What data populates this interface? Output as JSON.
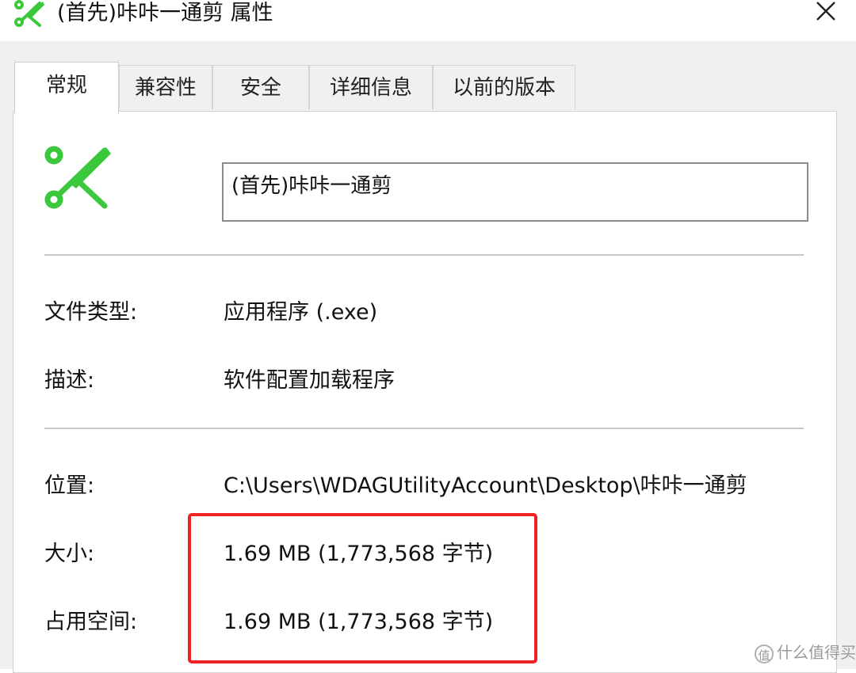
{
  "window": {
    "title": "(首先)咔咔一通剪 属性",
    "app_icon": "scissors-icon",
    "close_icon": "close-icon"
  },
  "tabs": [
    {
      "label": "常规",
      "active": true
    },
    {
      "label": "兼容性",
      "active": false
    },
    {
      "label": "安全",
      "active": false
    },
    {
      "label": "详细信息",
      "active": false
    },
    {
      "label": "以前的版本",
      "active": false
    }
  ],
  "general": {
    "file_icon": "scissors-icon",
    "file_name": "(首先)咔咔一通剪",
    "properties": [
      {
        "label": "文件类型:",
        "value": "应用程序 (.exe)"
      },
      {
        "label": "描述:",
        "value": "软件配置加载程序"
      },
      {
        "label": "位置:",
        "value": "C:\\Users\\WDAGUtilityAccount\\Desktop\\咔咔一通剪"
      },
      {
        "label": "大小:",
        "value": "1.69 MB (1,773,568 字节)"
      },
      {
        "label": "占用空间:",
        "value": "1.69 MB (1,773,568 字节)"
      }
    ]
  },
  "watermark": {
    "badge": "值",
    "text": "什么值得买"
  },
  "colors": {
    "icon_green": "#3cc83c",
    "highlight_red": "#ee2222",
    "dialog_bg": "#f0f0f0"
  }
}
